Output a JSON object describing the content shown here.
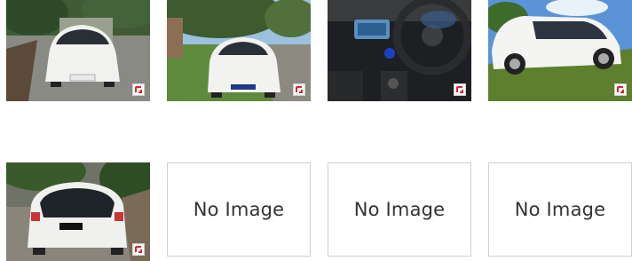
{
  "gallery": {
    "photos": [
      {
        "alt": "white hatchback front view on road",
        "badge_icon": "gallery-badge-icon"
      },
      {
        "alt": "white hatchback front view on grass",
        "badge_icon": "gallery-badge-icon"
      },
      {
        "alt": "dashboard and steering wheel interior",
        "badge_icon": "gallery-badge-icon"
      },
      {
        "alt": "white wagon side view on grass hill",
        "badge_icon": "gallery-badge-icon"
      },
      {
        "alt": "white hatchback rear view",
        "badge_icon": "gallery-badge-icon"
      }
    ],
    "placeholders": [
      {
        "label": "No Image"
      },
      {
        "label": "No Image"
      },
      {
        "label": "No Image"
      }
    ]
  },
  "colors": {
    "placeholder_border": "#cfcfcf",
    "placeholder_text": "#333333",
    "badge_red": "#d9262b"
  }
}
